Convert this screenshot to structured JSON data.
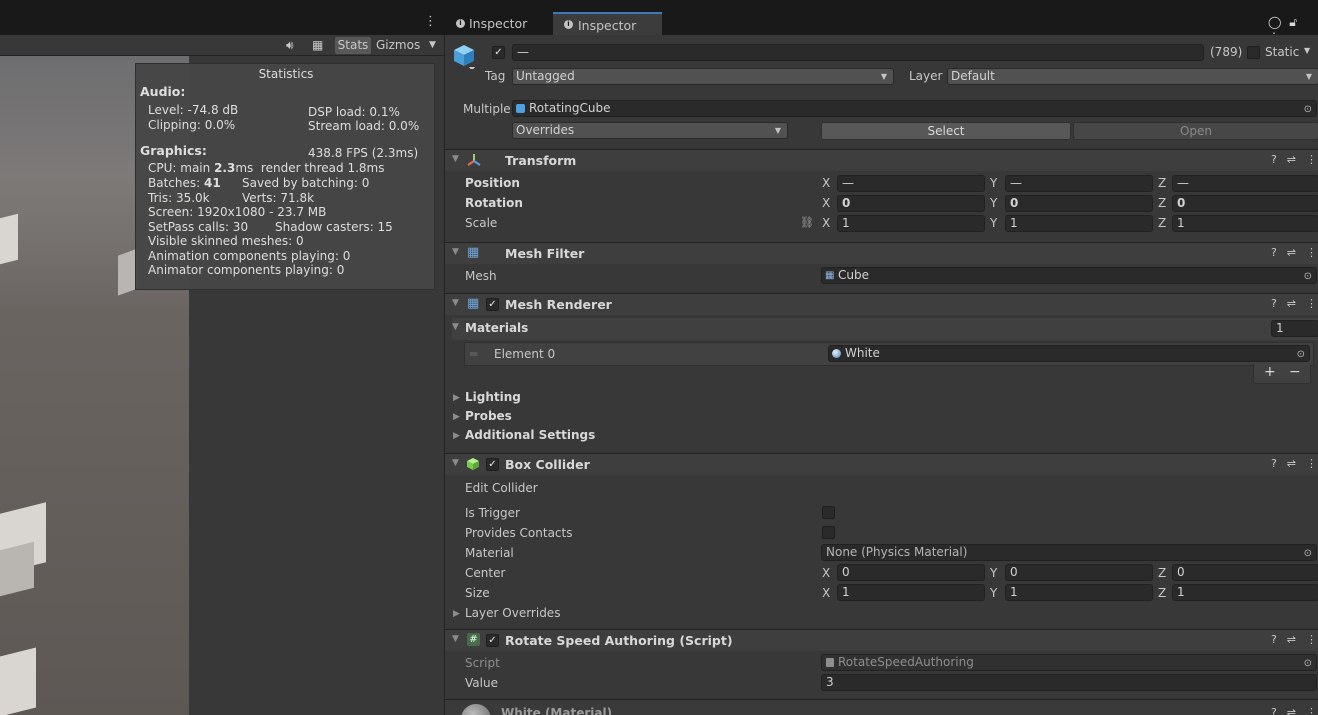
{
  "tabs": {
    "inspector_1": "Inspector",
    "inspector_2": "Inspector"
  },
  "scene_toolbar": {
    "stats": "Stats",
    "gizmos": "Gizmos"
  },
  "statistics": {
    "title": "Statistics",
    "audio_header": "Audio:",
    "level": "Level: -74.8 dB",
    "clipping": "Clipping: 0.0%",
    "dsp_load": "DSP load: 0.1%",
    "stream_load": "Stream load: 0.0%",
    "graphics_header": "Graphics:",
    "fps": "438.8 FPS (2.3ms)",
    "cpu_prefix": "CPU: main",
    "cpu_main_value": "2.3",
    "cpu_suffix": "ms  render thread 1.8ms",
    "batches_prefix": "Batches:",
    "batches_value": "41",
    "saved_by_batching": "Saved by batching: 0",
    "tris": "Tris: 35.0k",
    "verts": "Verts: 71.8k",
    "screen": "Screen: 1920x1080 - 23.7 MB",
    "setpass": "SetPass calls: 30",
    "shadow_casters": "Shadow casters: 15",
    "visible_skinned": "Visible skinned meshes: 0",
    "animation_components": "Animation components playing: 0",
    "animator_components": "Animator components playing: 0"
  },
  "inspector": {
    "object_name": "—",
    "count": "(789)",
    "static_label": "Static",
    "tag_label": "Tag",
    "tag_value": "Untagged",
    "layer_label": "Layer",
    "layer_value": "Default",
    "multiple_label": "Multiple",
    "prefab_name": "RotatingCube",
    "overrides_value": "Overrides",
    "select_label": "Select",
    "open_label": "Open",
    "transform": {
      "title": "Transform",
      "position_label": "Position",
      "rotation_label": "Rotation",
      "scale_label": "Scale",
      "x": "X",
      "y": "Y",
      "z": "Z",
      "position": [
        "—",
        "—",
        "—"
      ],
      "rotation": [
        "0",
        "0",
        "0"
      ],
      "scale": [
        "1",
        "1",
        "1"
      ]
    },
    "mesh_filter": {
      "title": "Mesh Filter",
      "mesh_label": "Mesh",
      "mesh_value": "Cube"
    },
    "mesh_renderer": {
      "title": "Mesh Renderer",
      "materials_label": "Materials",
      "materials_count": "1",
      "element_label": "Element 0",
      "element_value": "White",
      "add": "+",
      "remove": "−",
      "lighting": "Lighting",
      "probes": "Probes",
      "additional_settings": "Additional Settings"
    },
    "box_collider": {
      "title": "Box Collider",
      "edit_collider": "Edit Collider",
      "is_trigger": "Is Trigger",
      "provides_contacts": "Provides Contacts",
      "material_label": "Material",
      "material_value": "None (Physics Material)",
      "center_label": "Center",
      "size_label": "Size",
      "center": [
        "0",
        "0",
        "0"
      ],
      "size": [
        "1",
        "1",
        "1"
      ],
      "layer_overrides": "Layer Overrides"
    },
    "rotate_speed": {
      "title": "Rotate Speed Authoring (Script)",
      "script_label": "Script",
      "script_value": "RotateSpeedAuthoring",
      "value_label": "Value",
      "value": "3"
    },
    "material_footer": "White (Material)"
  },
  "colors": {
    "accent": "#3a79bb",
    "panel": "#383838",
    "field": "#2a2a2a",
    "header": "#3e3e3e"
  }
}
